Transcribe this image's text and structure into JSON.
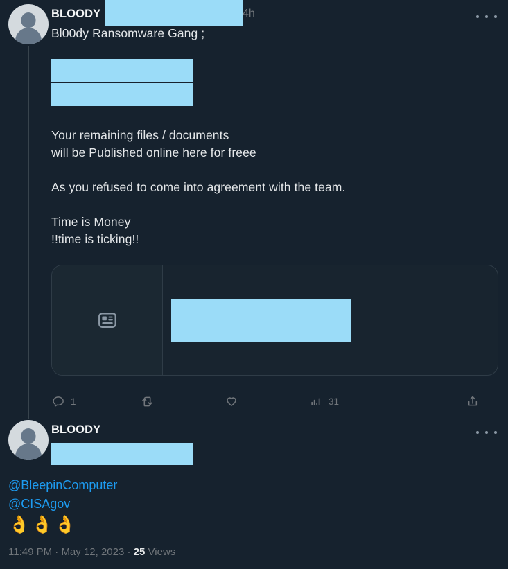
{
  "theme": {
    "background": "#16222e",
    "text": "#e7e9ea",
    "muted": "#71767b",
    "link": "#1d9bf0",
    "redaction": "#9bdcf8",
    "border": "#2f3c47"
  },
  "tweet_1": {
    "avatar_name": "default-user-avatar",
    "display_name": "BLOODY",
    "handle_redacted": true,
    "timestamp_relative": "4h",
    "more_label": "More",
    "subline": "Bl00dy Ransomware Gang ;",
    "redacted_blocks": 2,
    "body": "Your remaining files / documents\nwill be Published online here for freee\n\nAs you refused to come into agreement with the team.\n\nTime is Money\n!!time is ticking!!",
    "link_card": {
      "thumb_icon": "article-news-icon",
      "title_redacted": true
    },
    "actions": {
      "reply": {
        "icon": "reply-icon",
        "count": "1"
      },
      "retweet": {
        "icon": "retweet-icon",
        "count": ""
      },
      "like": {
        "icon": "heart-icon",
        "count": ""
      },
      "views": {
        "icon": "analytics-bar-icon",
        "count": "31"
      },
      "share": {
        "icon": "share-upload-icon",
        "count": ""
      }
    }
  },
  "tweet_2": {
    "avatar_name": "default-user-avatar",
    "display_name": "BLOODY",
    "handle_redacted": true,
    "more_label": "More",
    "mentions": [
      "@BleepinComputer",
      "@CISAgov"
    ],
    "emoji": "👌👌👌",
    "emoji_name": "ok-hand-emoji"
  },
  "footer": {
    "time": "11:49 PM",
    "sep_1": "·",
    "date": "May 12, 2023",
    "sep_2": "·",
    "views_count": "25",
    "views_label": "Views"
  }
}
